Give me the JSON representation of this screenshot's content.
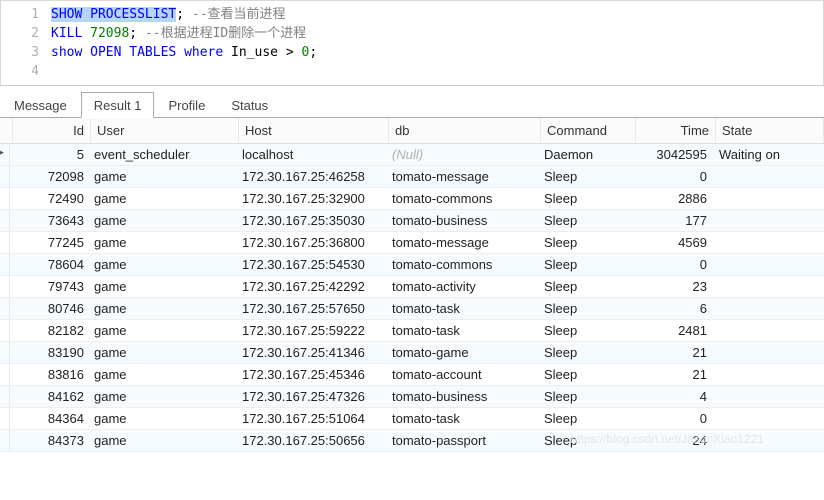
{
  "editor": {
    "lines": [
      {
        "n": "1",
        "tokens": [
          {
            "t": "SHOW PROCESSLIST",
            "c": "kw sel"
          },
          {
            "t": ";",
            "c": "punct"
          },
          {
            "t": " --查看当前进程",
            "c": "cmt"
          }
        ]
      },
      {
        "n": "2",
        "tokens": [
          {
            "t": "KILL",
            "c": "kw"
          },
          {
            "t": " ",
            "c": ""
          },
          {
            "t": "72098",
            "c": "num"
          },
          {
            "t": "; ",
            "c": "punct"
          },
          {
            "t": "--根据进程ID删除一个进程",
            "c": "cmt"
          }
        ]
      },
      {
        "n": "3",
        "tokens": [
          {
            "t": "show",
            "c": "kw"
          },
          {
            "t": " ",
            "c": ""
          },
          {
            "t": "OPEN TABLES",
            "c": "kw"
          },
          {
            "t": " ",
            "c": ""
          },
          {
            "t": "where",
            "c": "kw"
          },
          {
            "t": " In_use > ",
            "c": "id"
          },
          {
            "t": "0",
            "c": "num"
          },
          {
            "t": ";",
            "c": "punct"
          }
        ]
      },
      {
        "n": "4",
        "tokens": []
      }
    ]
  },
  "tabs": [
    {
      "label": "Message",
      "active": false
    },
    {
      "label": "Result 1",
      "active": true
    },
    {
      "label": "Profile",
      "active": false
    },
    {
      "label": "Status",
      "active": false
    }
  ],
  "columns": {
    "id": "Id",
    "user": "User",
    "host": "Host",
    "db": "db",
    "cmd": "Command",
    "time": "Time",
    "state": "State"
  },
  "rows": [
    {
      "id": "5",
      "user": "event_scheduler",
      "host": "localhost",
      "db": "(Null)",
      "db_null": true,
      "cmd": "Daemon",
      "time": "3042595",
      "state": "Waiting on",
      "active": true
    },
    {
      "id": "72098",
      "user": "game",
      "host": "172.30.167.25:46258",
      "db": "tomato-message",
      "cmd": "Sleep",
      "time": "0",
      "state": ""
    },
    {
      "id": "72490",
      "user": "game",
      "host": "172.30.167.25:32900",
      "db": "tomato-commons",
      "cmd": "Sleep",
      "time": "2886",
      "state": ""
    },
    {
      "id": "73643",
      "user": "game",
      "host": "172.30.167.25:35030",
      "db": "tomato-business",
      "cmd": "Sleep",
      "time": "177",
      "state": ""
    },
    {
      "id": "77245",
      "user": "game",
      "host": "172.30.167.25:36800",
      "db": "tomato-message",
      "cmd": "Sleep",
      "time": "4569",
      "state": ""
    },
    {
      "id": "78604",
      "user": "game",
      "host": "172.30.167.25:54530",
      "db": "tomato-commons",
      "cmd": "Sleep",
      "time": "0",
      "state": ""
    },
    {
      "id": "79743",
      "user": "game",
      "host": "172.30.167.25:42292",
      "db": "tomato-activity",
      "cmd": "Sleep",
      "time": "23",
      "state": ""
    },
    {
      "id": "80746",
      "user": "game",
      "host": "172.30.167.25:57650",
      "db": "tomato-task",
      "cmd": "Sleep",
      "time": "6",
      "state": ""
    },
    {
      "id": "82182",
      "user": "game",
      "host": "172.30.167.25:59222",
      "db": "tomato-task",
      "cmd": "Sleep",
      "time": "2481",
      "state": ""
    },
    {
      "id": "83190",
      "user": "game",
      "host": "172.30.167.25:41346",
      "db": "tomato-game",
      "cmd": "Sleep",
      "time": "21",
      "state": ""
    },
    {
      "id": "83816",
      "user": "game",
      "host": "172.30.167.25:45346",
      "db": "tomato-account",
      "cmd": "Sleep",
      "time": "21",
      "state": ""
    },
    {
      "id": "84162",
      "user": "game",
      "host": "172.30.167.25:47326",
      "db": "tomato-business",
      "cmd": "Sleep",
      "time": "4",
      "state": ""
    },
    {
      "id": "84364",
      "user": "game",
      "host": "172.30.167.25:51064",
      "db": "tomato-task",
      "cmd": "Sleep",
      "time": "0",
      "state": ""
    },
    {
      "id": "84373",
      "user": "game",
      "host": "172.30.167.25:50656",
      "db": "tomato-passport",
      "cmd": "Sleep",
      "time": "24",
      "state": ""
    }
  ],
  "watermark": "https://blog.csdn.net/JasonXiao1221"
}
